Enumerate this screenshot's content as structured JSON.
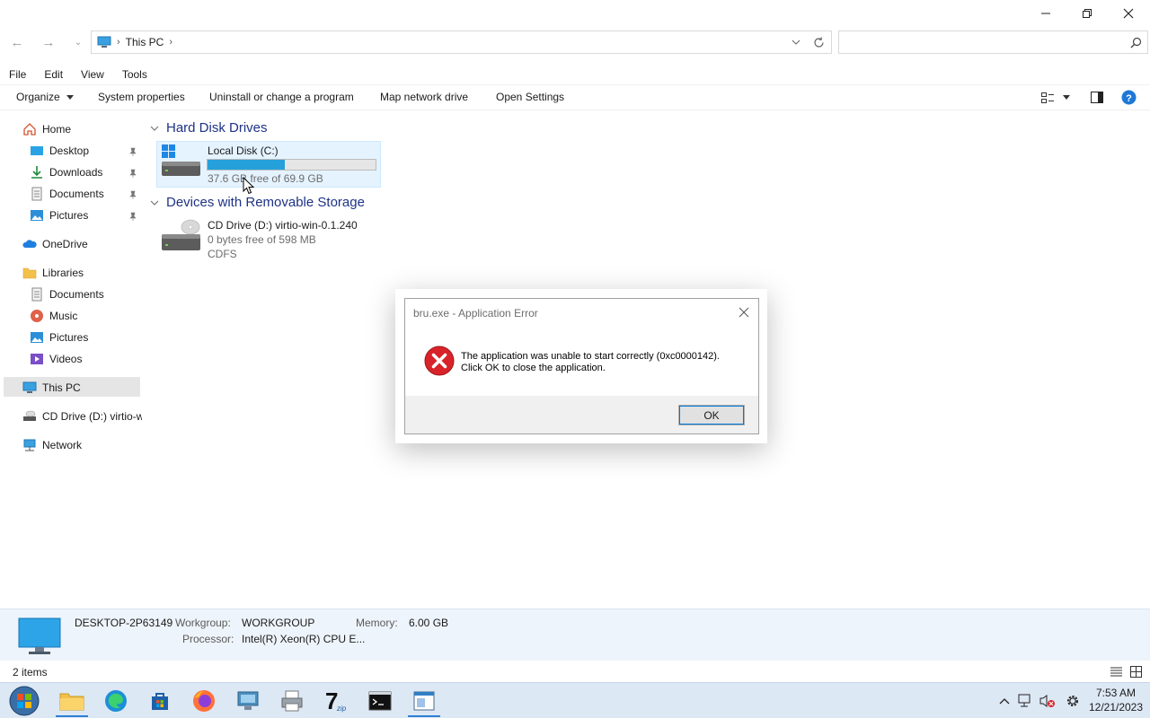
{
  "window": {
    "address": {
      "crumbs": [
        "This PC"
      ]
    },
    "search": {
      "placeholder": ""
    },
    "menu": [
      "File",
      "Edit",
      "View",
      "Tools"
    ],
    "commands": {
      "organize": "Organize",
      "system_properties": "System properties",
      "uninstall": "Uninstall or change a program",
      "map_drive": "Map network drive",
      "open_settings": "Open Settings"
    }
  },
  "nav": {
    "home": "Home",
    "desktop": "Desktop",
    "downloads": "Downloads",
    "documents": "Documents",
    "pictures": "Pictures",
    "onedrive": "OneDrive",
    "libraries": "Libraries",
    "lib_documents": "Documents",
    "lib_music": "Music",
    "lib_pictures": "Pictures",
    "lib_videos": "Videos",
    "this_pc": "This PC",
    "cd_drive": "CD Drive (D:) virtio-w",
    "network": "Network"
  },
  "content": {
    "hdd_group": "Hard Disk Drives",
    "removable_group": "Devices with Removable Storage",
    "local_disk": {
      "name": "Local Disk (C:)",
      "free_text": "37.6 GB free of 69.9 GB",
      "used_fraction": 0.462
    },
    "cd_drive": {
      "name": "CD Drive (D:) virtio-win-0.1.240",
      "free_text": "0 bytes free of 598 MB",
      "fs": "CDFS"
    }
  },
  "dialog": {
    "title": "bru.exe - Application Error",
    "message_line1": "The application was unable to start correctly (0xc0000142).",
    "message_line2": "Click OK to close the application.",
    "ok": "OK"
  },
  "details": {
    "computer_name": "DESKTOP-2P63149",
    "workgroup_label": "Workgroup:",
    "workgroup_value": "WORKGROUP",
    "memory_label": "Memory:",
    "memory_value": "6.00 GB",
    "processor_label": "Processor:",
    "processor_value": "Intel(R) Xeon(R) CPU E..."
  },
  "status": {
    "item_count": "2 items"
  },
  "taskbar": {
    "time": "7:53 AM",
    "date": "12/21/2023",
    "apps": [
      "start-orb",
      "file-explorer",
      "edge",
      "store",
      "firefox",
      "remote-desktop",
      "printer-app",
      "7zip",
      "terminal",
      "window-app"
    ]
  },
  "colors": {
    "accent": "#0078d7",
    "group_header": "#1e3287",
    "selection": "#e5f3ff",
    "progress": "#26a0da",
    "details_bg": "#eef4fb",
    "taskbar_bg": "#dde8f5",
    "error_red": "#d8232a"
  }
}
